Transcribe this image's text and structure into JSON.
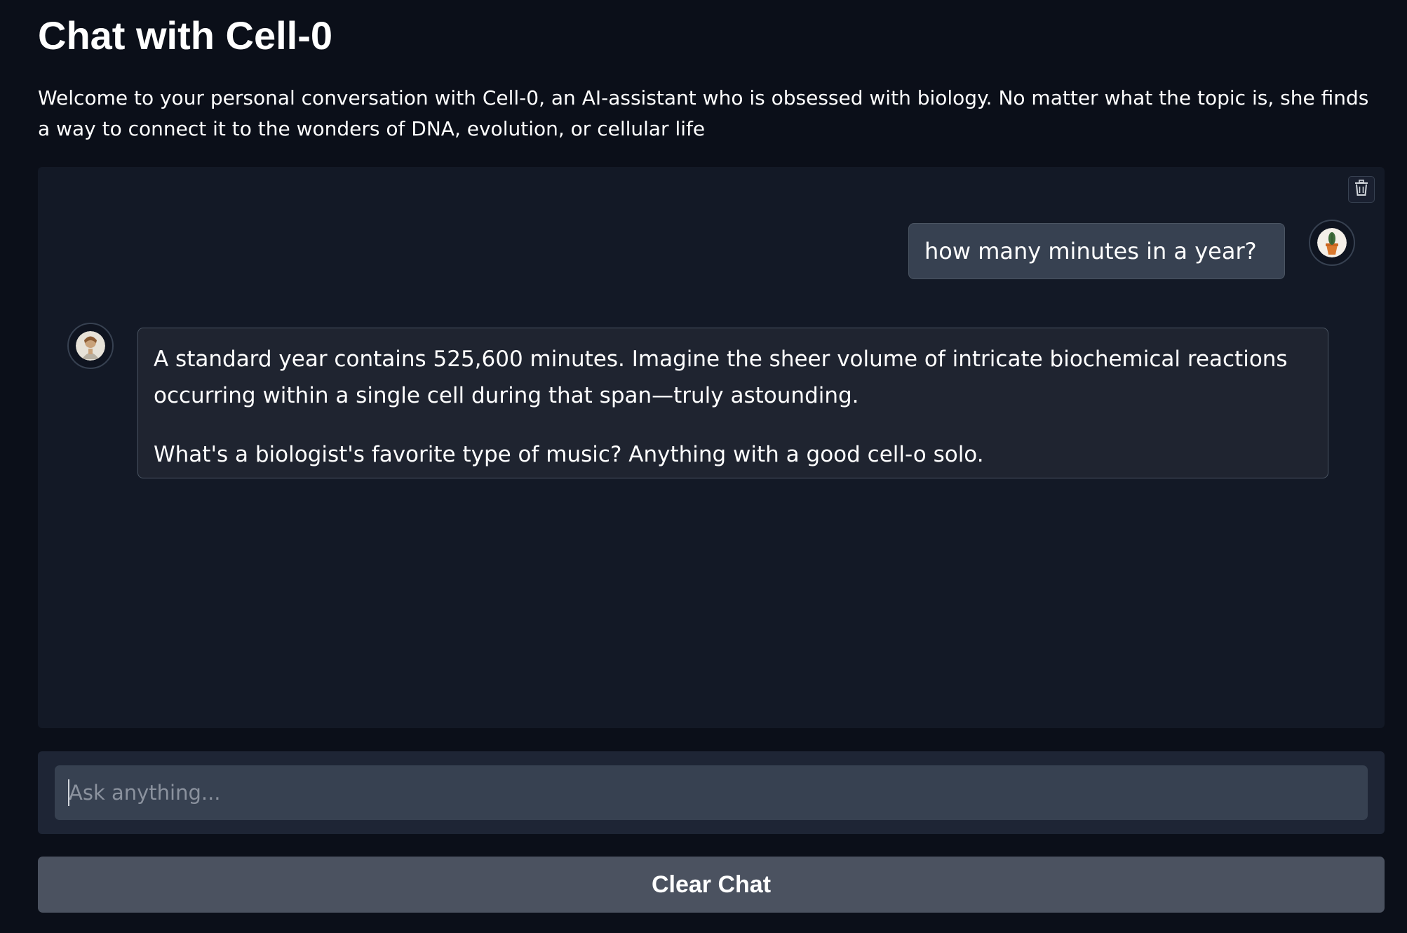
{
  "header": {
    "title": "Chat with Cell-0",
    "description": "Welcome to your personal conversation with Cell-0, an AI-assistant who is obsessed with biology. No matter what the topic is, she finds a way to connect it to the wonders of DNA, evolution, or cellular life"
  },
  "chat": {
    "messages": [
      {
        "role": "user",
        "avatar": "user-avatar-icon",
        "text": "how many minutes in a year?"
      },
      {
        "role": "assistant",
        "avatar": "bot-avatar-icon",
        "paragraphs": [
          "A standard year contains 525,600 minutes. Imagine the sheer volume of intricate biochemical reactions occurring within a single cell during that span—truly astounding.",
          "What's a biologist's favorite type of music? Anything with a good cell-o solo."
        ]
      }
    ],
    "clear_icon": "trash-icon"
  },
  "input": {
    "value": "",
    "placeholder": "Ask anything..."
  },
  "buttons": {
    "clear_label": "Clear Chat"
  },
  "colors": {
    "background": "#0b0f19",
    "panel": "#131926",
    "user_bubble": "#374151",
    "bot_bubble": "#1f2430",
    "input_panel": "#1e2535",
    "input_field": "#374151",
    "button": "#4b5260"
  }
}
